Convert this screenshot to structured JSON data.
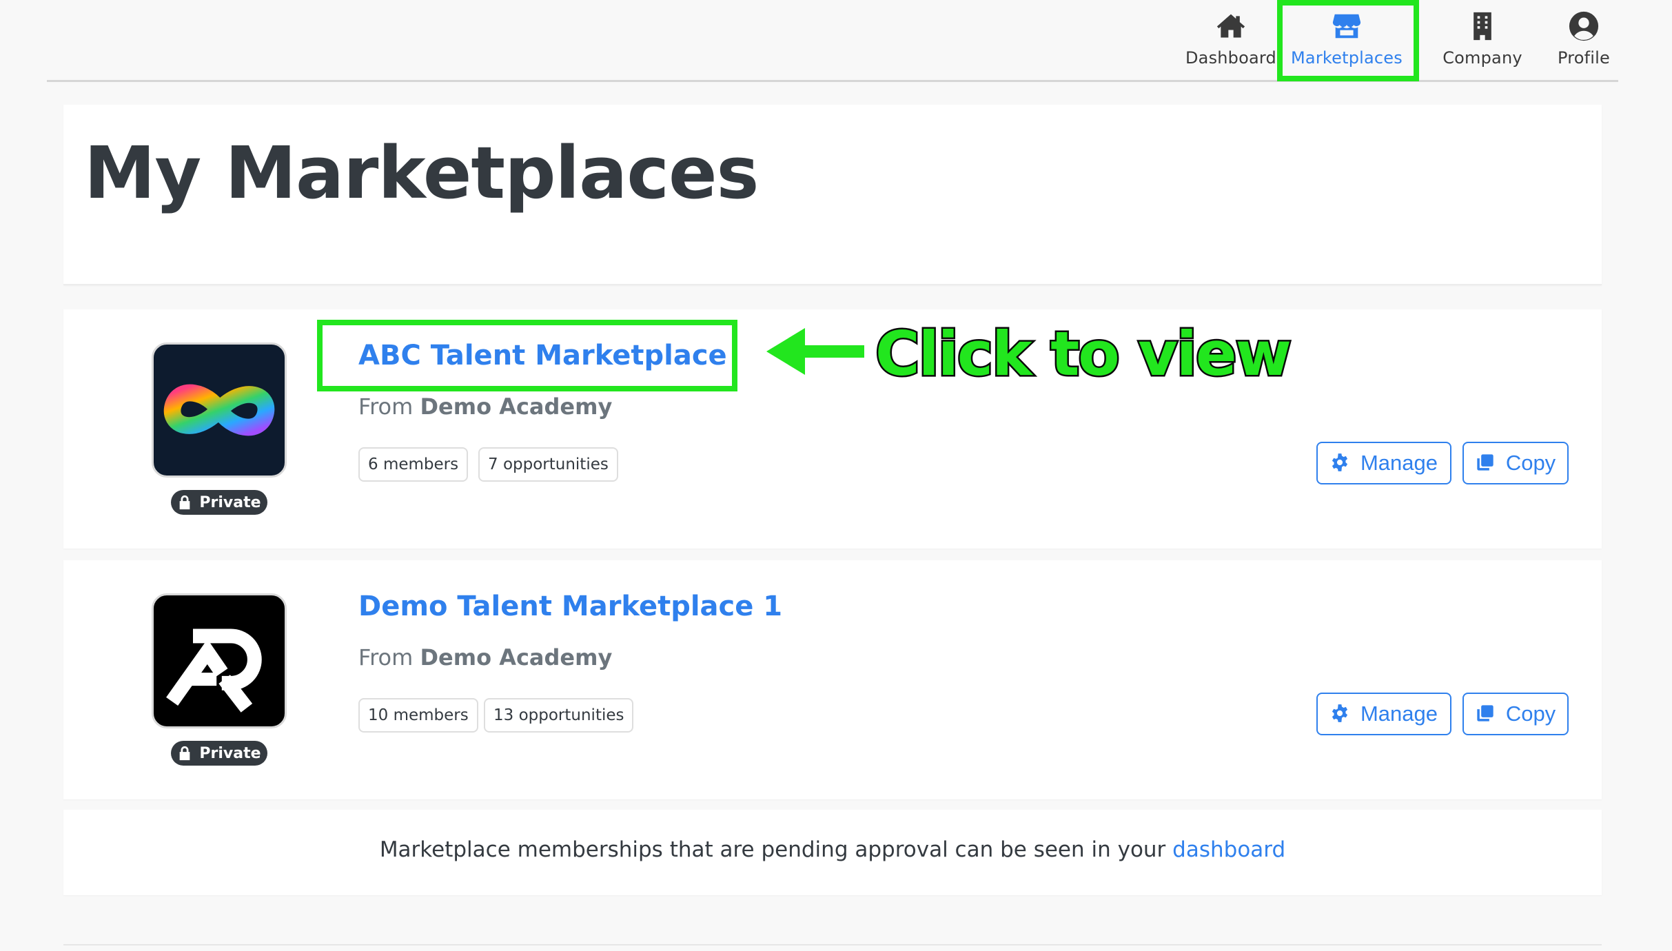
{
  "nav": {
    "items": [
      {
        "label": "Dashboard",
        "icon": "home-icon"
      },
      {
        "label": "Marketplaces",
        "icon": "store-icon",
        "active": true
      },
      {
        "label": "Company",
        "icon": "building-icon"
      },
      {
        "label": "Profile",
        "icon": "user-circle-icon"
      }
    ]
  },
  "page": {
    "title": "My Marketplaces"
  },
  "marketplaces": [
    {
      "name": "ABC Talent Marketplace",
      "from_prefix": "From",
      "from_org": "Demo Academy",
      "visibility": "Private",
      "members": "6 members",
      "opportunities": "7 opportunities",
      "logo": "infinity-logo",
      "manage_label": "Manage",
      "copy_label": "Copy"
    },
    {
      "name": "Demo Talent Marketplace 1",
      "from_prefix": "From",
      "from_org": "Demo Academy",
      "visibility": "Private",
      "members": "10 members",
      "opportunities": "13 opportunities",
      "logo": "ar-logo",
      "manage_label": "Manage",
      "copy_label": "Copy"
    }
  ],
  "annotation": {
    "text": "Click to view"
  },
  "note": {
    "text": "Marketplace memberships that are pending approval can be seen in your",
    "link": "dashboard"
  },
  "colors": {
    "accent": "#2f80ed",
    "highlight": "#22e61e",
    "heading": "#343a40",
    "badge_bg": "#343a40"
  }
}
